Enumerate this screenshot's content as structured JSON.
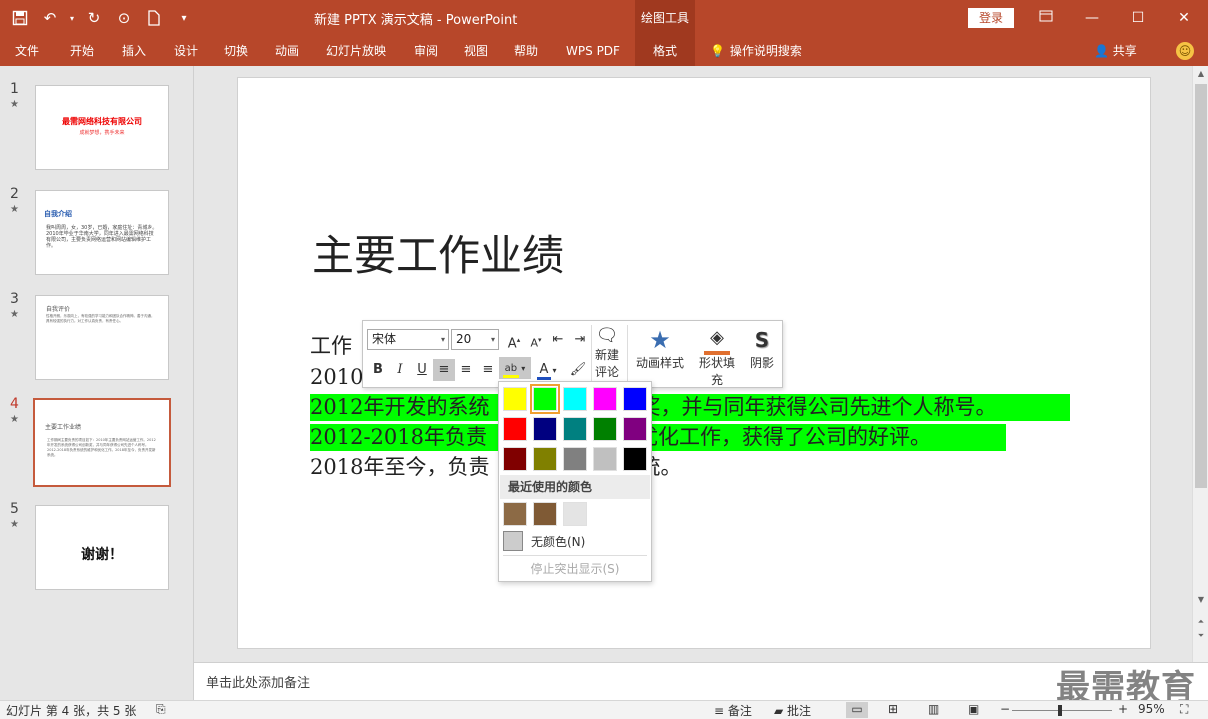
{
  "window": {
    "title": "新建 PPTX 演示文稿 - PowerPoint",
    "context_tab_title": "绘图工具",
    "login_label": "登录"
  },
  "ribbon": {
    "tabs": [
      "文件",
      "开始",
      "插入",
      "设计",
      "切换",
      "动画",
      "幻灯片放映",
      "审阅",
      "视图",
      "帮助",
      "WPS PDF",
      "格式"
    ],
    "active_tab": "格式",
    "search_label": "操作说明搜索",
    "share_label": "共享"
  },
  "thumbnails": [
    {
      "num": "1",
      "title": "最需网络科技有限公司",
      "subtitle": "成就梦想，携手未来"
    },
    {
      "num": "2",
      "title": "自我介绍",
      "body": "我叫周周，女，30岁，已婚，家庭住址：青城乡。2010年毕业于华南大学，同年进入最需网络科技有限公司，主要负责网络运营和网站编辑维护工作。"
    },
    {
      "num": "3",
      "title": "自我评价",
      "body": "性格开朗，乐观向上，有较强的学习能力和团队合作精神。善于沟通，具有较强的执行力。对工作认真负责，有责任心。"
    },
    {
      "num": "4",
      "title": "主要工作业绩",
      "body": "工作期间主要负责的项目如下：2010年主要负责网站运营工作。2012年开发的系统获得公司创新奖，并与同年获得公司先进个人称号。2012-2018年负责系统的维护和优化工作。2018年至今，负责开发新系统。"
    },
    {
      "num": "5",
      "title": "谢谢！"
    }
  ],
  "slide": {
    "title": "主要工作业绩",
    "lines": [
      {
        "text": "工作",
        "highlight": false
      },
      {
        "text": "2010",
        "highlight": false
      },
      {
        "text": "2012年开发的系统",
        "tail": "奖，并与同年获得公司先进个人称号。",
        "highlight": true
      },
      {
        "text": "2012-2018年负责",
        "tail": "优化工作，获得了公司的好评。",
        "highlight": true
      },
      {
        "text": "2018年至今，负责",
        "tail": "统。",
        "highlight": false
      }
    ]
  },
  "mini_toolbar": {
    "font_name": "宋体",
    "font_size": "20",
    "new_comment_label": "新建评论",
    "animation_style_label": "动画样式",
    "shape_fill_label": "形状填充",
    "shadow_label": "阴影"
  },
  "color_panel": {
    "standard_colors": [
      "#ffff00",
      "#00ff00",
      "#00ffff",
      "#ff00ff",
      "#0000ff",
      "#ff0000",
      "#000080",
      "#008080",
      "#008000",
      "#800080",
      "#800000",
      "#808000",
      "#808080",
      "#c0c0c0",
      "#000000"
    ],
    "selected_color": "#00ff00",
    "recent_header": "最近使用的颜色",
    "recent_colors": [
      "#8c6a45",
      "#7f5a35",
      "#e4e4e4"
    ],
    "no_color_label": "无颜色(N)",
    "stop_highlight_label": "停止突出显示(S)"
  },
  "notes": {
    "placeholder": "单击此处添加备注"
  },
  "watermark": "最需教育",
  "statusbar": {
    "slide_info": "幻灯片 第 4 张，共 5 张",
    "notes_label": "备注",
    "comments_label": "批注",
    "zoom": "95%"
  },
  "colors": {
    "accent": "#b7472a",
    "accent_dark": "#a0391f",
    "highlight": "#00ff00"
  }
}
